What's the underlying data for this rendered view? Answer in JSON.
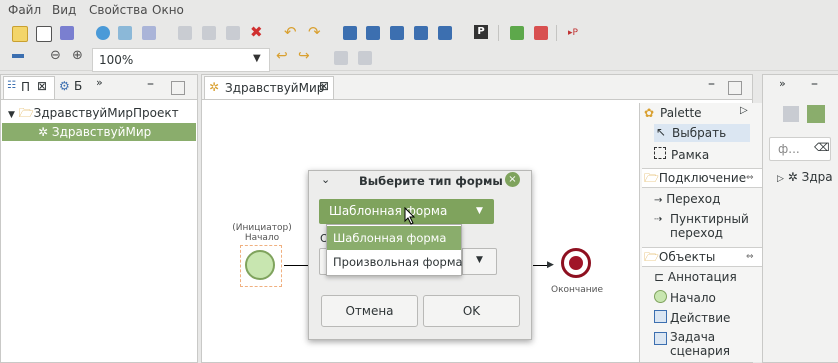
{
  "menu": {
    "items": [
      "Файл",
      "Вид",
      "Свойства",
      "Окно"
    ]
  },
  "toolbar": {
    "zoom_value": "100%"
  },
  "left_panel": {
    "tabs": [
      "П",
      "Б"
    ],
    "tree": {
      "project": "ЗдравствуйМирПроект",
      "process": "ЗдравствуйМир"
    }
  },
  "editor": {
    "tab_label": "ЗдравствуйМир",
    "start_top_label": "(Инициатор)",
    "start_label": "Начало",
    "end_label": "Окончание"
  },
  "palette": {
    "title": "Palette",
    "tools": [
      "Выбрать",
      "Рамка"
    ],
    "groups": [
      {
        "label": "Подключение",
        "items": [
          "Переход",
          "Пунктирный переход"
        ]
      },
      {
        "label": "Объекты",
        "items": [
          "Аннотация",
          "Начало",
          "Действие",
          "Задача сценария"
        ]
      }
    ]
  },
  "right_panel": {
    "search_placeholder": "ф...",
    "tree_item": "Здра"
  },
  "dialog": {
    "title": "Выберите тип формы",
    "selected_value": "Шаблонная форма",
    "second_label_prefix": "О",
    "options": [
      "Шаблонная форма",
      "Произвольная форма"
    ],
    "cancel_label": "Отмена",
    "ok_label": "OK"
  }
}
